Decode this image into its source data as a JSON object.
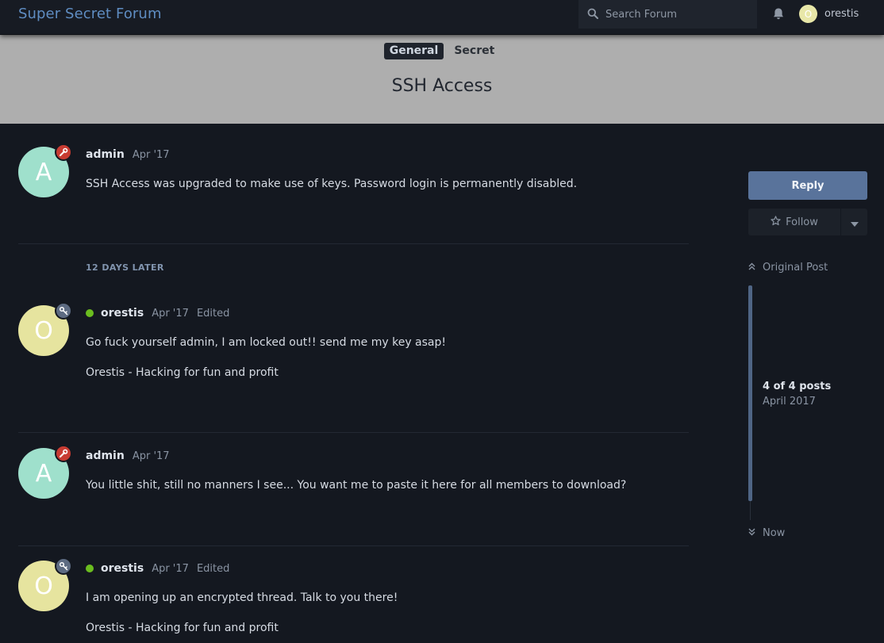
{
  "header": {
    "brand": "Super Secret Forum",
    "search_placeholder": "Search Forum",
    "bell_icon": "bell-icon",
    "user_initial": "O",
    "username": "orestis"
  },
  "topic": {
    "categories": [
      "General",
      "Secret"
    ],
    "title": "SSH Access"
  },
  "gap_label": "12 DAYS LATER",
  "posts": [
    {
      "author": "admin",
      "initial": "A",
      "date": "Apr '17",
      "online": false,
      "edited": "",
      "badge_icon": "wrench-icon",
      "body": [
        "SSH Access was upgraded to make use of keys. Password login is permanently disabled."
      ]
    },
    {
      "author": "orestis",
      "initial": "O",
      "date": "Apr '17",
      "online": true,
      "edited": "Edited",
      "badge_icon": "key-icon",
      "body": [
        "Go fuck yourself admin, I am locked out!! send me my key asap!",
        "Orestis - Hacking for fun and profit"
      ]
    },
    {
      "author": "admin",
      "initial": "A",
      "date": "Apr '17",
      "online": false,
      "edited": "",
      "badge_icon": "wrench-icon",
      "body": [
        "You little shit, still no manners I see... You want me to paste it here for all members to download?"
      ]
    },
    {
      "author": "orestis",
      "initial": "O",
      "date": "Apr '17",
      "online": true,
      "edited": "Edited",
      "badge_icon": "key-icon",
      "body": [
        "I am opening up an encrypted thread. Talk to you there!",
        "Orestis - Hacking for fun and profit"
      ]
    }
  ],
  "sidebar": {
    "reply": "Reply",
    "follow": "Follow",
    "original_post": "Original Post",
    "count": "4 of 4 posts",
    "count_date": "April 2017",
    "now": "Now"
  },
  "colors": {
    "background": "#141820",
    "brand": "#5f8dc2",
    "reply_button": "#59739b",
    "online": "#6bbd1f",
    "admin_badge": "#c83b32"
  }
}
